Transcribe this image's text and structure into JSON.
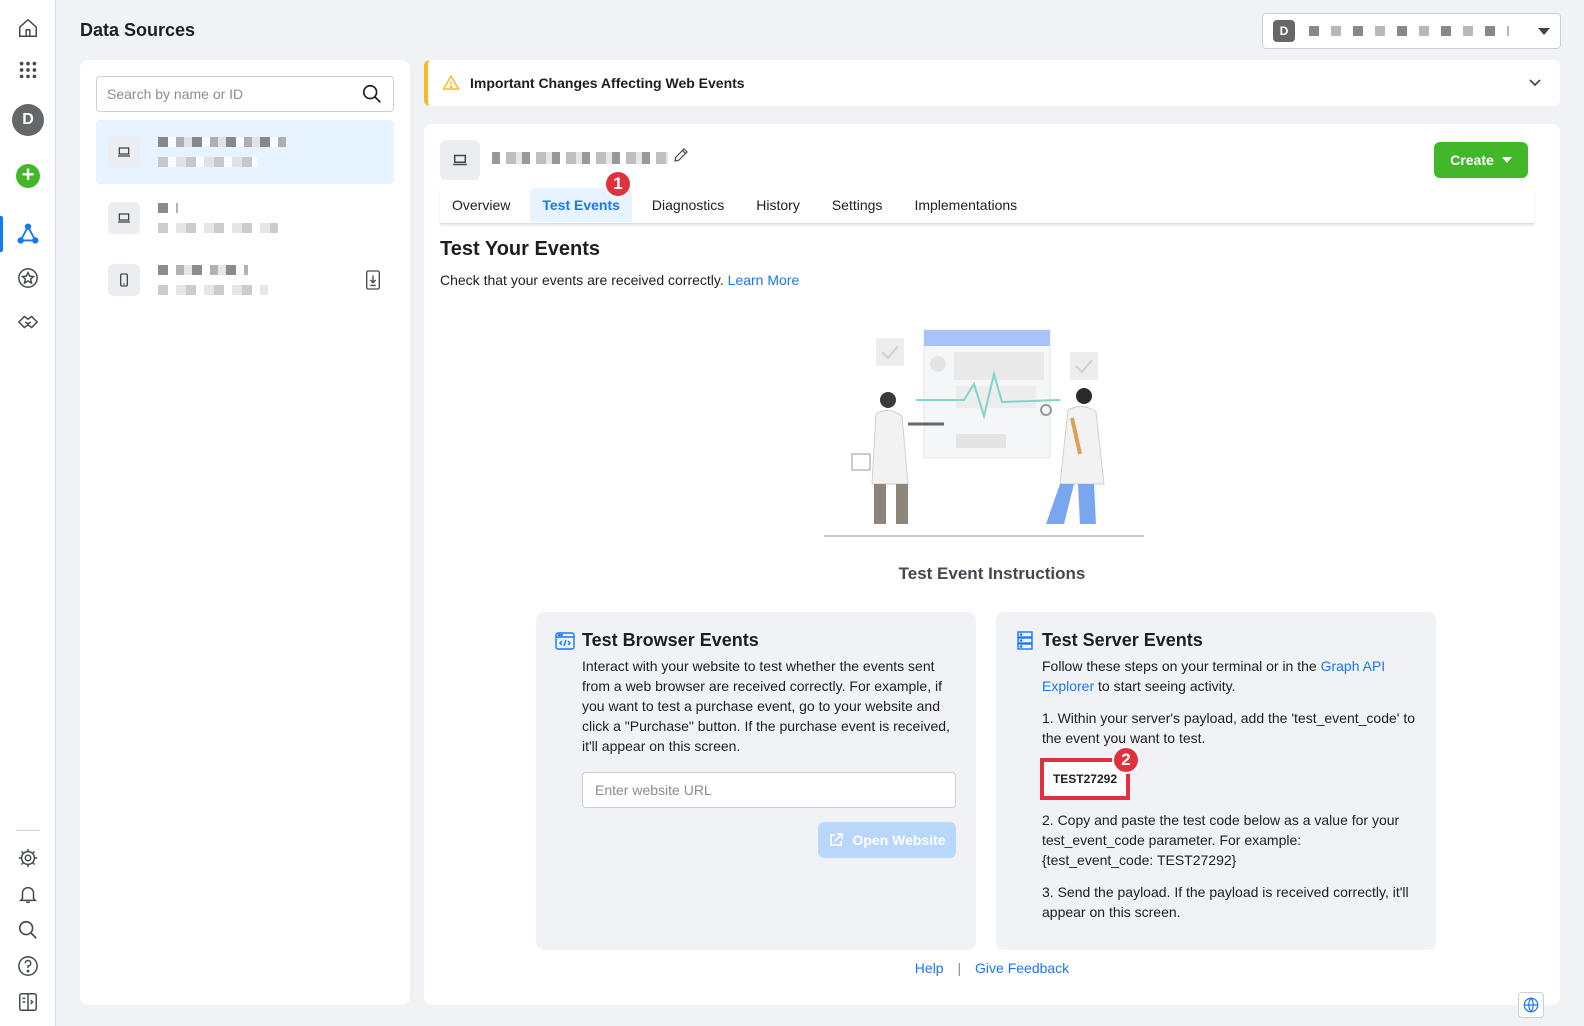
{
  "header": {
    "title": "Data Sources",
    "account_initial": "D"
  },
  "rail": {
    "avatar_initial": "D",
    "plus": "+"
  },
  "search": {
    "placeholder": "Search by name or ID"
  },
  "banner": {
    "title": "Important Changes Affecting Web Events"
  },
  "create": {
    "label": "Create"
  },
  "tabs": [
    "Overview",
    "Test Events",
    "Diagnostics",
    "History",
    "Settings",
    "Implementations"
  ],
  "badges": {
    "one": "1",
    "two": "2"
  },
  "page": {
    "heading": "Test Your Events",
    "subtitle": "Check that your events are received correctly.",
    "learn_more": "Learn More",
    "instructions_title": "Test Event Instructions"
  },
  "browser": {
    "title": "Test Browser Events",
    "text": "Interact with your website to test whether the events sent from a web browser are received correctly. For example, if you want to test a purchase event, go to your website and click a \"Purchase\" button. If the purchase event is received, it'll appear on this screen.",
    "url_placeholder": "Enter website URL",
    "open_label": "Open Website"
  },
  "server": {
    "title": "Test Server Events",
    "intro_before": "Follow these steps on your terminal or in the",
    "intro_link": "Graph API Explorer",
    "intro_after": "to start seeing activity.",
    "step1": "1. Within your server's payload, add the 'test_event_code' to the event you want to test.",
    "code": "TEST27292",
    "step2": "2. Copy and paste the test code below as a value for your test_event_code parameter. For example: {test_event_code: TEST27292}",
    "step3": "3. Send the payload. If the payload is received correctly, it'll appear on this screen."
  },
  "footer": {
    "help": "Help",
    "separator": "|",
    "feedback": "Give Feedback"
  },
  "colors": {
    "accent": "#1877f2",
    "create": "#42b72a",
    "warning": "#f7b928",
    "badge": "#e0323e"
  }
}
